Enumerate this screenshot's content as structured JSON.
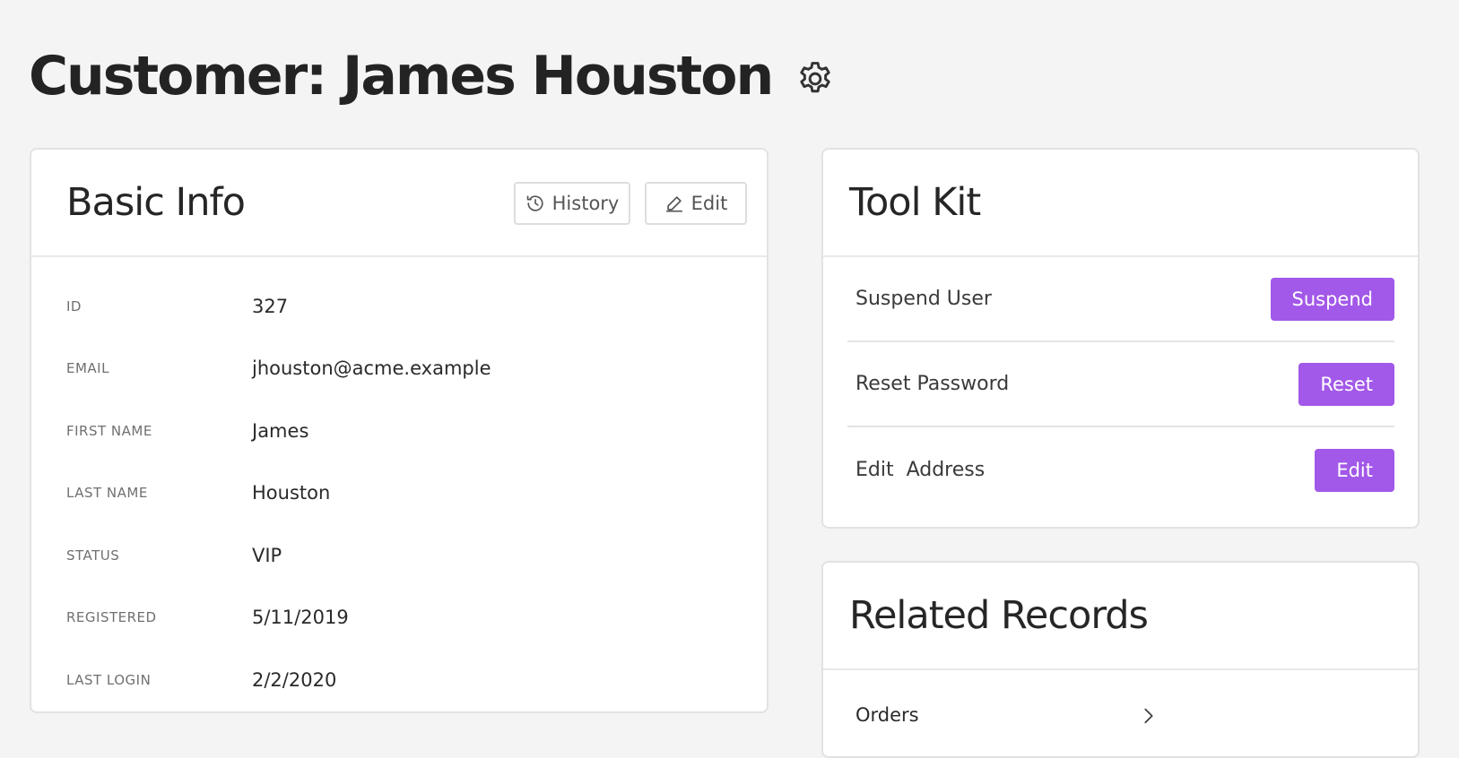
{
  "page": {
    "title": "Customer: James Houston",
    "settings_icon": "gear-icon"
  },
  "basic_info": {
    "title": "Basic Info",
    "history_label": "History",
    "history_icon": "history-icon",
    "edit_label": "Edit",
    "edit_icon": "pencil-icon",
    "fields": [
      {
        "label": "ID",
        "value": "327"
      },
      {
        "label": "EMAIL",
        "value": "jhouston@acme.example"
      },
      {
        "label": "FIRST NAME",
        "value": "James"
      },
      {
        "label": "LAST NAME",
        "value": "Houston"
      },
      {
        "label": "STATUS",
        "value": "VIP"
      },
      {
        "label": "REGISTERED",
        "value": "5/11/2019"
      },
      {
        "label": "LAST LOGIN",
        "value": "2/2/2020"
      }
    ]
  },
  "tool_kit": {
    "title": "Tool Kit",
    "actions": [
      {
        "label": "Suspend User",
        "button": "Suspend"
      },
      {
        "label": "Reset Password",
        "button": "Reset"
      },
      {
        "label": "Edit  Address",
        "button": "Edit"
      }
    ]
  },
  "related_records": {
    "title": "Related Records",
    "items": [
      {
        "label": "Orders",
        "icon": "chevron-right-icon"
      }
    ]
  },
  "colors": {
    "accent": "#a258e8",
    "background": "#f4f4f4",
    "card": "#ffffff"
  }
}
